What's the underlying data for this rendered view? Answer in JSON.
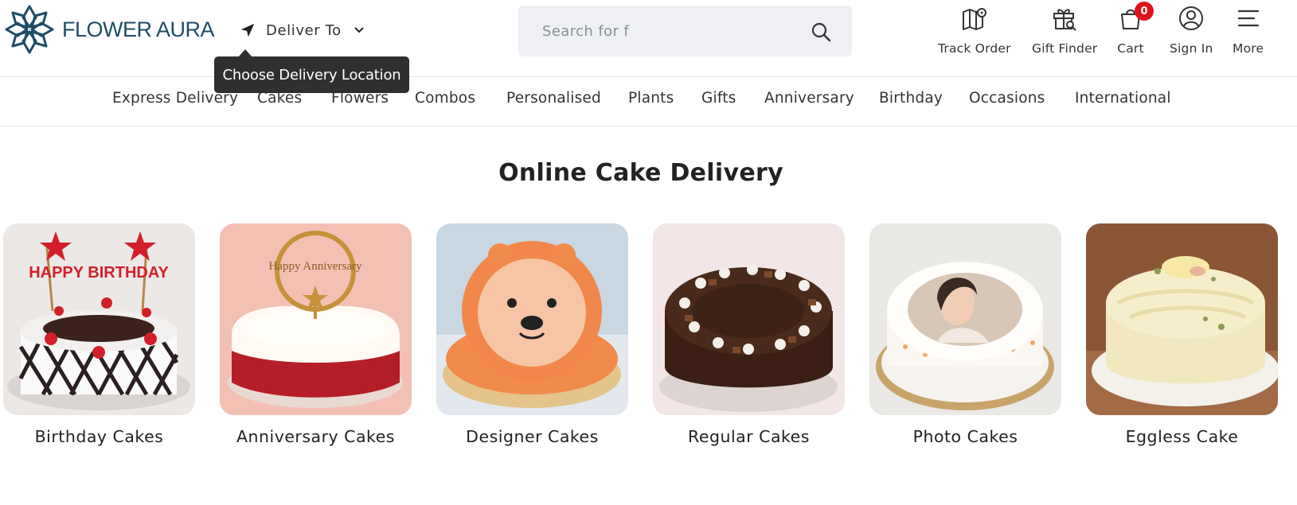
{
  "header": {
    "logo_text": "FLOWER AURA",
    "deliver_label": "Deliver To",
    "tooltip": "Choose Delivery Location",
    "search_placeholder": "Search for f",
    "actions": [
      {
        "label": "Track Order",
        "icon": "map-pin-icon"
      },
      {
        "label": "Gift Finder",
        "icon": "gift-search-icon"
      },
      {
        "label": "Cart",
        "icon": "cart-bag-icon",
        "badge": "0"
      },
      {
        "label": "Sign In",
        "icon": "user-circle-icon"
      },
      {
        "label": "More",
        "icon": "menu-icon"
      }
    ]
  },
  "nav": {
    "items": [
      "Express Delivery",
      "Cakes",
      "Flowers",
      "Combos",
      "Personalised",
      "Plants",
      "Gifts",
      "Anniversary",
      "Birthday",
      "Occasions",
      "International"
    ]
  },
  "main": {
    "heading": "Online Cake Delivery",
    "categories": [
      {
        "label": "Birthday Cakes",
        "topper": "HAPPY BIRTHDAY"
      },
      {
        "label": "Anniversary Cakes",
        "topper": "Happy Anniversary"
      },
      {
        "label": "Designer Cakes"
      },
      {
        "label": "Regular Cakes"
      },
      {
        "label": "Photo Cakes"
      },
      {
        "label": "Eggless Cake"
      }
    ]
  },
  "colors": {
    "brand": "#1d4c66",
    "badge": "#e0121d",
    "tooltip_bg": "#2f2f2f",
    "search_bg": "#eef0f3"
  }
}
